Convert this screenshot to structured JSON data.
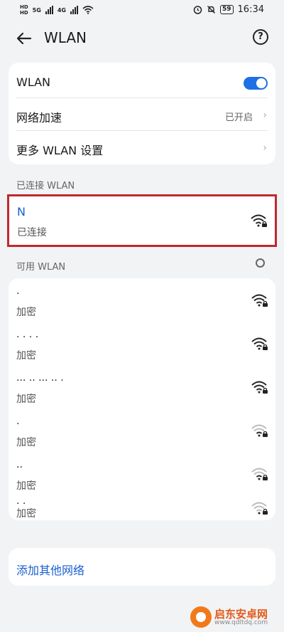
{
  "status_bar": {
    "left_hd_top": "HD",
    "left_hd_bottom": "HD",
    "sig1_label": "5G",
    "sig2_label": "4G",
    "battery": "59",
    "time": "16:34"
  },
  "header": {
    "title": "WLAN",
    "help": "?"
  },
  "settings": [
    {
      "label": "WLAN",
      "type": "toggle",
      "on": true
    },
    {
      "label": "网络加速",
      "type": "value",
      "value": "已开启"
    },
    {
      "label": "更多 WLAN 设置",
      "type": "chevron"
    }
  ],
  "connected": {
    "section_label": "已连接 WLAN",
    "name": "N",
    "status": "已连接"
  },
  "available": {
    "section_label": "可用 WLAN",
    "networks": [
      {
        "name": "·",
        "security": "加密",
        "signal": "strong"
      },
      {
        "name": "·  ·  ·  ·",
        "security": "加密",
        "signal": "strong"
      },
      {
        "name": "··· ·· ··· ·· ·",
        "security": "加密",
        "signal": "strong"
      },
      {
        "name": "·",
        "security": "加密",
        "signal": "weak"
      },
      {
        "name": "··",
        "security": "加密",
        "signal": "weak"
      },
      {
        "name": "· ·",
        "security": "加密",
        "signal": "weak"
      }
    ]
  },
  "add_network": {
    "label": "添加其他网络"
  },
  "watermark": {
    "text": "启东安卓网",
    "url": "www.qdltdq.com"
  },
  "colors": {
    "accent": "#1f6fe5",
    "link": "#1a5fd0",
    "highlight_border": "#c0282e"
  }
}
